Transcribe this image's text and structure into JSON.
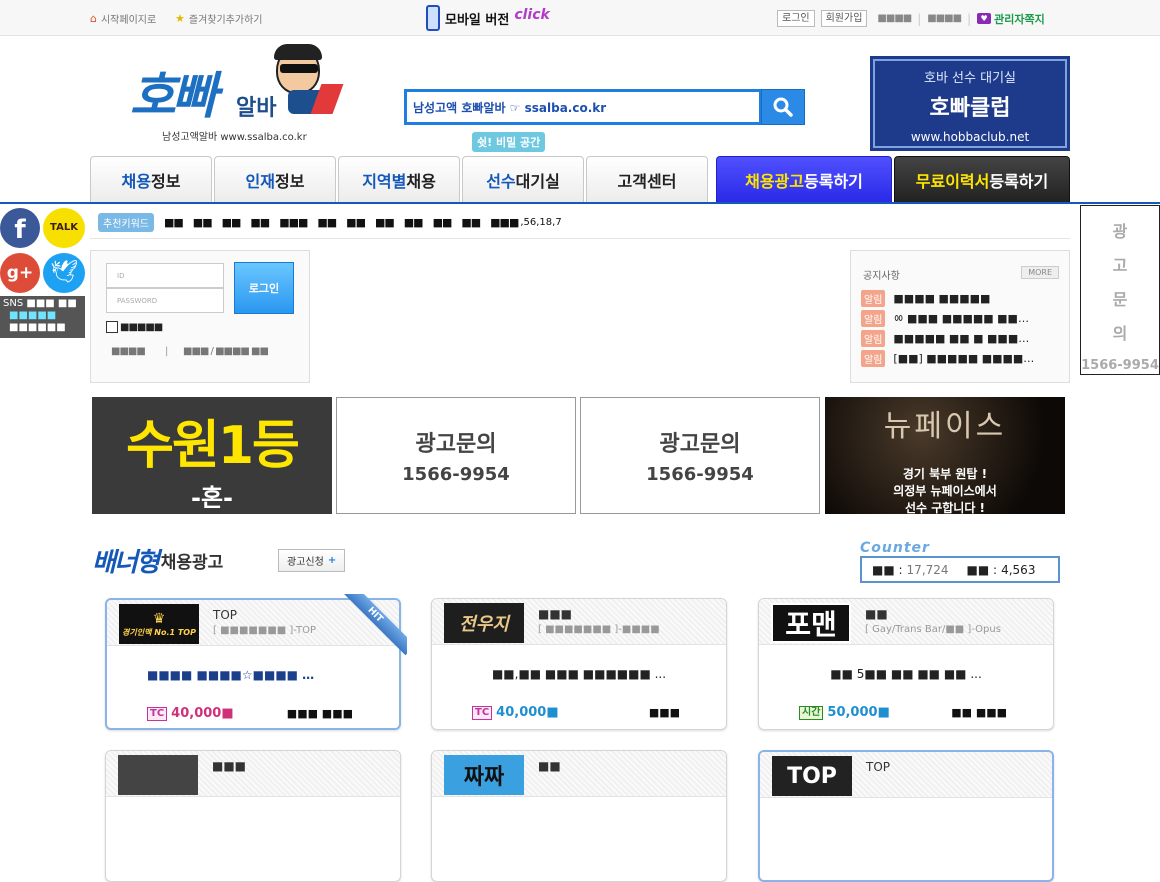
{
  "topbar": {
    "start_page": "시작페이지로",
    "bookmark": "즐겨찾기추가하기",
    "mobile": "모바일 버전",
    "click": "click",
    "login": "로그인",
    "join": "회원가입",
    "sq1": "■■■■",
    "sq2": "■■■■",
    "admin_msg": "관리자쪽지"
  },
  "logo": {
    "main": "호빠",
    "sub": "알바",
    "tagline": "남성고액알바  www.ssalba.co.kr"
  },
  "search": {
    "value": "남성고액 호빠알바 ☞ ssalba.co.kr"
  },
  "right_banner": {
    "line1": "호바 선수 대기실",
    "line2": "호빠클럽",
    "line3": "www.hobbaclub.net"
  },
  "bubble": "쉿! 비밀 공간",
  "nav": [
    {
      "hl": "채용",
      "rest": "정보"
    },
    {
      "hl": "인재",
      "rest": "정보"
    },
    {
      "hl": "지역별",
      "rest": "채용"
    },
    {
      "hl": "선수",
      "rest": "대기실"
    },
    {
      "hl": "",
      "rest": "고객센터"
    },
    {
      "hl": "채용광고",
      "rest": " 등록하기"
    },
    {
      "hl": "무료이력서",
      "rest": " 등록하기"
    }
  ],
  "keywords": {
    "label": "추천키워드",
    "items": [
      "■■",
      "■■",
      "■■",
      "■■",
      "■■■",
      "■■",
      "■■",
      "■■",
      "■■",
      "■■",
      "■■",
      "■■■"
    ],
    "tail": ",56,18,7"
  },
  "social": {
    "sns_label": "SNS",
    "sns_sq": "■■■ ■■",
    "row2": "■■■■■",
    "row3": "■■■■■■"
  },
  "login": {
    "id_placeholder": "ID",
    "pw_placeholder": "PASSWORD",
    "button": "로그인",
    "auto": "■■■■■",
    "find1": "■■■■",
    "find2": "■■■ / ■■■■ ■■"
  },
  "notice": {
    "title": "공지사항",
    "more": "MORE",
    "badge": "알림",
    "items": [
      "■■■■ ■■■■■",
      "ㆀ ■■■ ■■■■■ ■■…",
      "■■■■■ ■■ ■ ■■■…",
      "[■■] ■■■■■ ■■■■…"
    ]
  },
  "ad_side": {
    "chars": [
      "광",
      "고",
      "문",
      "의"
    ],
    "phone": "1566-9954"
  },
  "ads": [
    {
      "line1": "수원1등",
      "line2": "-혼-"
    },
    {
      "line1": "광고문의",
      "line2": "1566-9954"
    },
    {
      "line1": "광고문의",
      "line2": "1566-9954"
    },
    {
      "line1": "뉴페이스",
      "line2": "경기 북부 원탑 !",
      "line3": "의정부 뉴페이스에서",
      "line4": "선수 구합니다 !"
    }
  ],
  "section": {
    "title_hl": "배너형",
    "title_rest": "채용광고",
    "apply": "광고신청"
  },
  "counter": {
    "title": "Counter",
    "label1": "■■ :",
    "value1": "17,724",
    "label2": "■■ :",
    "value2": "4,563"
  },
  "cards": [
    {
      "logo": "경기인맥 No.1 TOP",
      "name": "TOP",
      "sub": "[ ■■■■■■■ ]-TOP",
      "title": "■■■■ ■■■■☆■■■■ …",
      "tag": "TC",
      "pay": "40,000■",
      "loc": "■■■ ■■■",
      "ribbon": "HIT"
    },
    {
      "logo": "전우지",
      "name": "■■■",
      "sub": "[ ■■■■■■■ ]-■■■■",
      "title": "■■,■■ ■■■ ■■■■■■ ...",
      "tag": "TC",
      "pay": "40,000■",
      "loc": "■■■",
      "ribbon": ""
    },
    {
      "logo": "포맨",
      "name": "■■",
      "sub": "[ Gay/Trans Bar/■■ ]-Opus",
      "title": "■■ 5■■ ■■ ■■ ■■ ...",
      "tag": "시간",
      "pay": "50,000■",
      "loc": "■■ ■■■",
      "ribbon": ""
    }
  ],
  "cards_row2": [
    {
      "name": "■■■",
      "logo": ""
    },
    {
      "name": "■■",
      "logo": "짜짜"
    },
    {
      "name": "TOP",
      "logo": "TOP"
    }
  ],
  "colors": {
    "blue": "#1458b8",
    "purple_btn": "#3a3aff",
    "dark_btn": "#2b2b2b",
    "yellow": "#ffe600"
  }
}
